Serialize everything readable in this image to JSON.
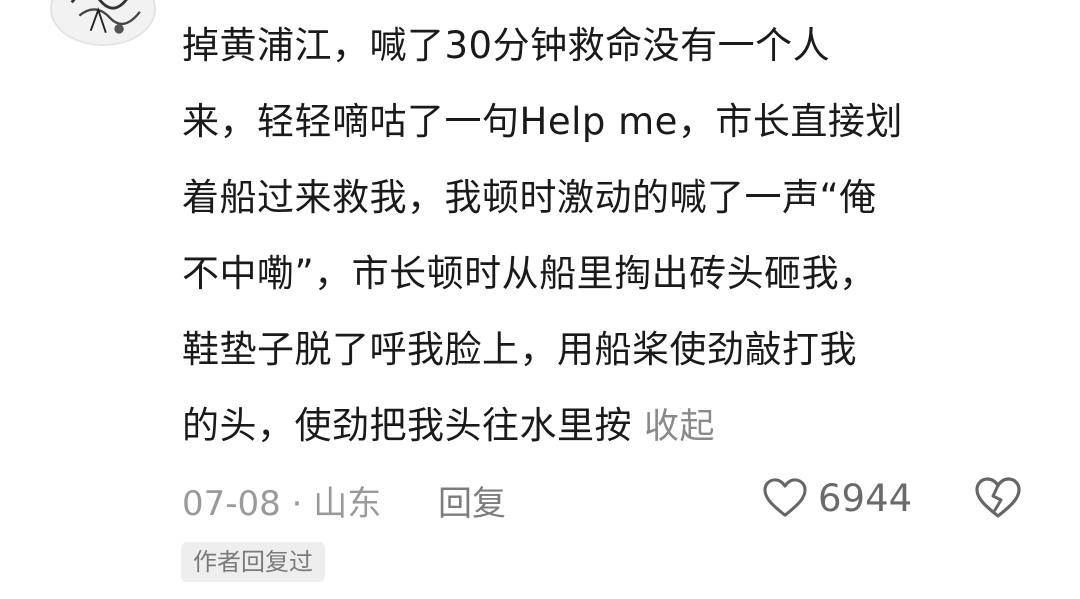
{
  "comment": {
    "lines": [
      "掉黄浦江，喊了30分钟救命没有一个人",
      "来，轻轻嘀咕了一句Help me，市长直接划",
      "着船过来救我，我顿时激动的喊了一声“俺",
      "不中嘞”，市长顿时从船里掏出砖头砸我，",
      "鞋垫子脱了呼我脸上，用船桨使劲敲打我",
      "的头，使劲把我头往水里按"
    ],
    "collapse_label": "收起"
  },
  "meta": {
    "date_location": "07-08 · 山东",
    "reply_label": "回复",
    "like_count": "6944"
  },
  "badge": {
    "author_replied": "作者回复过"
  },
  "icons": {
    "avatar": "avatar",
    "like": "heart-outline-icon",
    "dislike": "broken-heart-icon"
  },
  "colors": {
    "text": "#1a1a1a",
    "muted": "#9a9a9a",
    "badge_bg": "#eeeeee"
  }
}
